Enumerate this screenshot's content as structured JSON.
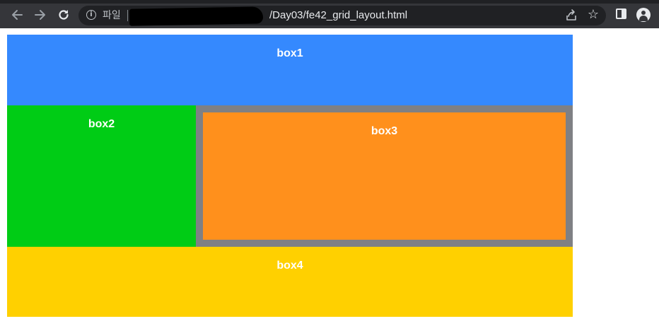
{
  "browser": {
    "security_label": "파일",
    "url_visible": "/Day03/fe42_grid_layout.html",
    "icons": {
      "back": "back-arrow-icon",
      "forward": "forward-arrow-icon",
      "reload": "reload-icon",
      "info": "info-icon",
      "share": "share-icon",
      "bookmark": "star-icon",
      "side_panel": "side-panel-icon",
      "profile": "profile-avatar-icon"
    }
  },
  "page": {
    "box1": {
      "label": "box1",
      "color": "#3589fe"
    },
    "box2": {
      "label": "box2",
      "color": "#00cc15"
    },
    "box3": {
      "label": "box3",
      "color": "#ff901c",
      "border_color": "#7f8084"
    },
    "box4": {
      "label": "box4",
      "color": "#ffd000"
    }
  },
  "colors": {
    "toolbar_bg": "#35363a",
    "omnibox_bg": "#202124",
    "text_light": "#e8eaed"
  }
}
